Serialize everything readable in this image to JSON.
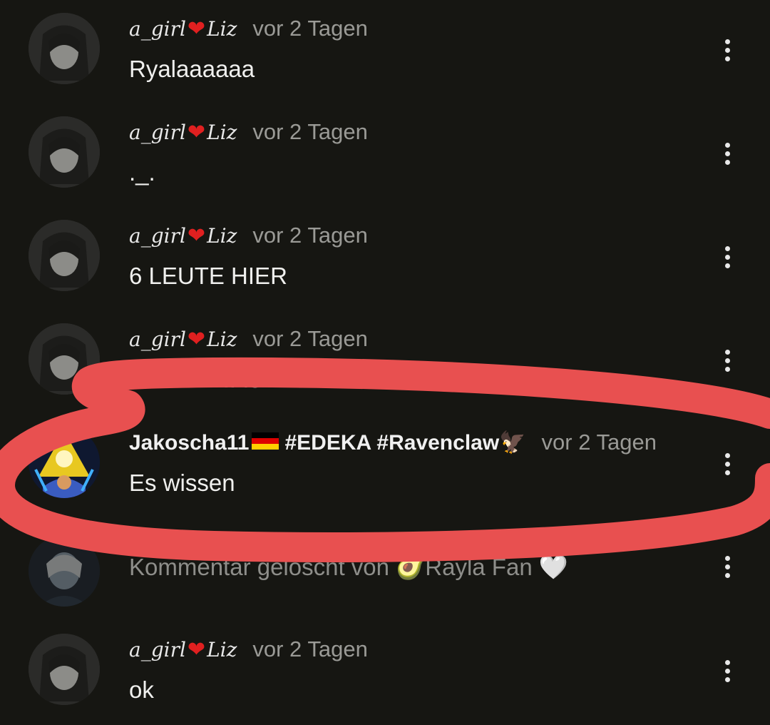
{
  "comments": [
    {
      "user": "a_girl",
      "user2": "Liz",
      "time": "vor 2 Tagen",
      "text": "Ryalaaaaaa"
    },
    {
      "user": "a_girl",
      "user2": "Liz",
      "time": "vor 2 Tagen",
      "text": "._."
    },
    {
      "user": "a_girl",
      "user2": "Liz",
      "time": "vor 2 Tagen",
      "text": "6 LEUTE HIER"
    },
    {
      "user": "a_girl",
      "user2": "Liz",
      "time": "vor 2 Tagen",
      "text": "DIGGA WAS WOLLT IHR ALLE VON MIR"
    },
    {
      "user": "Jakoscha11",
      "tags": "#EDEKA #Ravenclaw",
      "time": "vor 2 Tagen",
      "text": "Es wissen",
      "highlighted": true
    },
    {
      "deleted_text": "Kommentar gelöscht von 🥑Rayla Fan 🤍"
    },
    {
      "user": "a_girl",
      "user2": "Liz",
      "time": "vor 2 Tagen",
      "text": "ok"
    }
  ],
  "icons": {
    "menu": "more-vertical-icon",
    "heart": "heart-icon",
    "flag": "german-flag-icon",
    "eagle": "eagle-icon"
  },
  "colors": {
    "background": "#161612",
    "highlight_stroke": "#e85050",
    "heart": "#e02020"
  }
}
